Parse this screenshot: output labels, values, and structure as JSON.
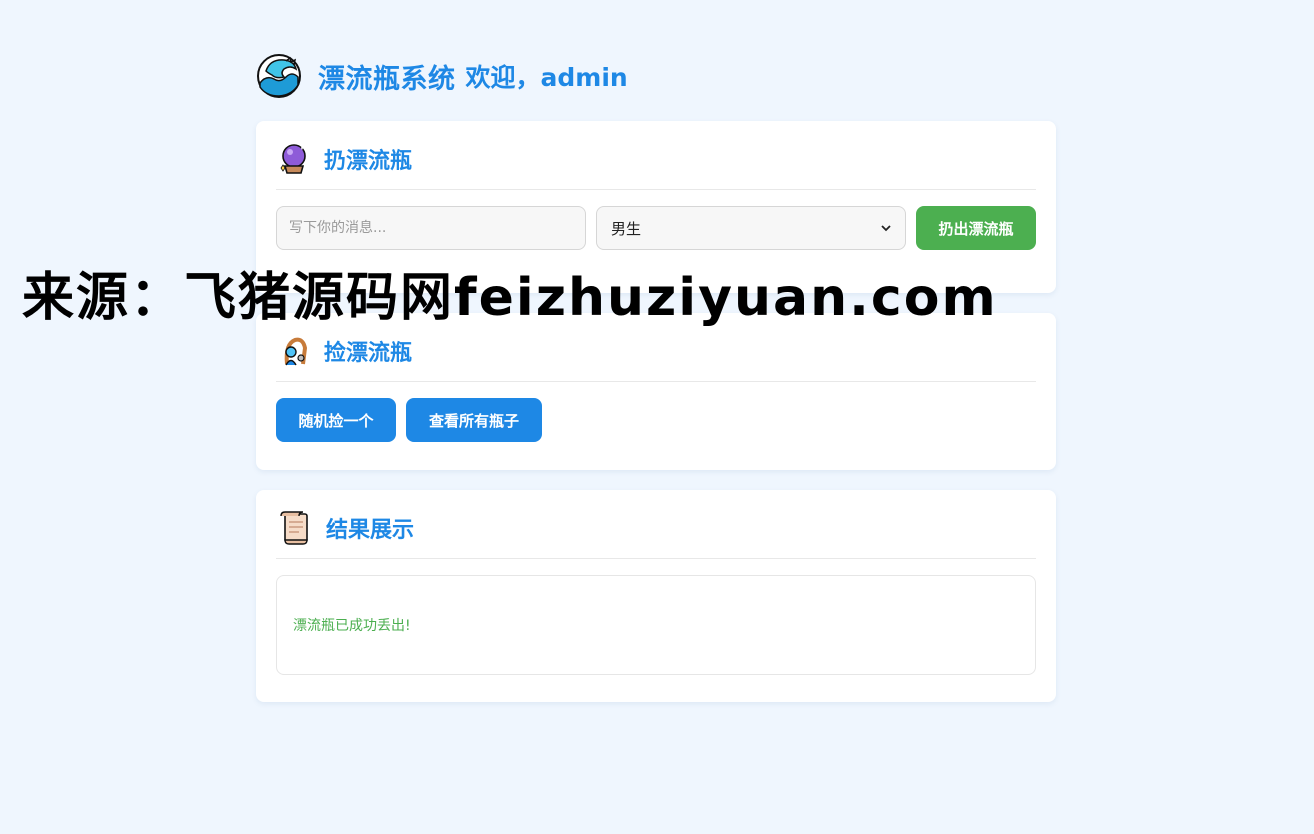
{
  "header": {
    "logo_icon": "wave-icon",
    "title": "漂流瓶系统",
    "welcome": "欢迎，admin"
  },
  "throw_card": {
    "icon": "crystal-ball-icon",
    "title": "扔漂流瓶",
    "message_placeholder": "写下你的消息...",
    "gender_selected": "男生",
    "throw_button": "扔出漂流瓶"
  },
  "pick_card": {
    "icon": "fishing-person-icon",
    "title": "捡漂流瓶",
    "random_button": "随机捡一个",
    "all_button": "查看所有瓶子"
  },
  "result_card": {
    "icon": "scroll-icon",
    "title": "结果展示",
    "message": "漂流瓶已成功丢出!"
  },
  "watermark": "来源：飞猪源码网feizhuziyuan.com",
  "colors": {
    "accent": "#1e88e5",
    "success": "#4caf50",
    "background": "#eff6fe"
  }
}
